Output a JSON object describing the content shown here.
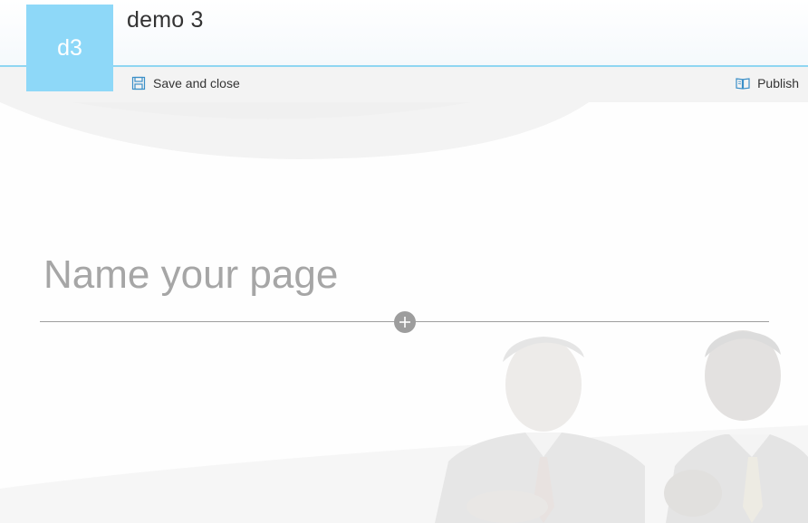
{
  "site": {
    "logo_text": "d3",
    "title": "demo 3"
  },
  "command_bar": {
    "save_close_label": "Save and close",
    "publish_label": "Publish"
  },
  "editor": {
    "title_placeholder": "Name your page",
    "title_value": ""
  },
  "icons": {
    "save": "save-icon",
    "publish": "book-icon",
    "add_section": "plus-icon"
  },
  "colors": {
    "accent": "#8ed8f8",
    "header_rule": "#8fd6f2",
    "command_bar_bg": "#f3f3f3",
    "placeholder": "#a6a6a6",
    "add_button": "#9d9d9d"
  }
}
